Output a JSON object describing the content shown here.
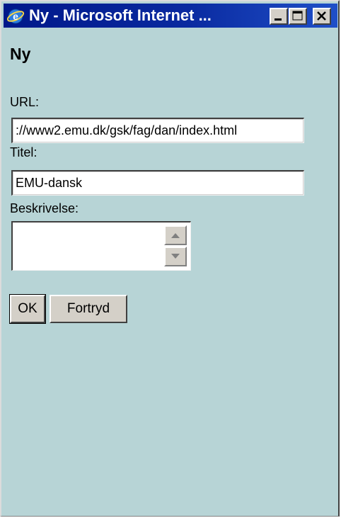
{
  "window": {
    "title": "Ny - Microsoft Internet ...",
    "controls": {
      "minimize": "minimize",
      "maximize": "maximize",
      "close": "close"
    }
  },
  "page": {
    "heading": "Ny",
    "url": {
      "label": "URL:",
      "value": "://www2.emu.dk/gsk/fag/dan/index.html"
    },
    "titel": {
      "label": "Titel:",
      "value": "EMU-dansk"
    },
    "beskrivelse": {
      "label": "Beskrivelse:",
      "value": ""
    },
    "buttons": {
      "ok": "OK",
      "cancel": "Fortryd"
    }
  },
  "colors": {
    "background": "#b7d4d6",
    "titlebar": "#0a2aa0",
    "button_face": "#d4d0c8"
  }
}
